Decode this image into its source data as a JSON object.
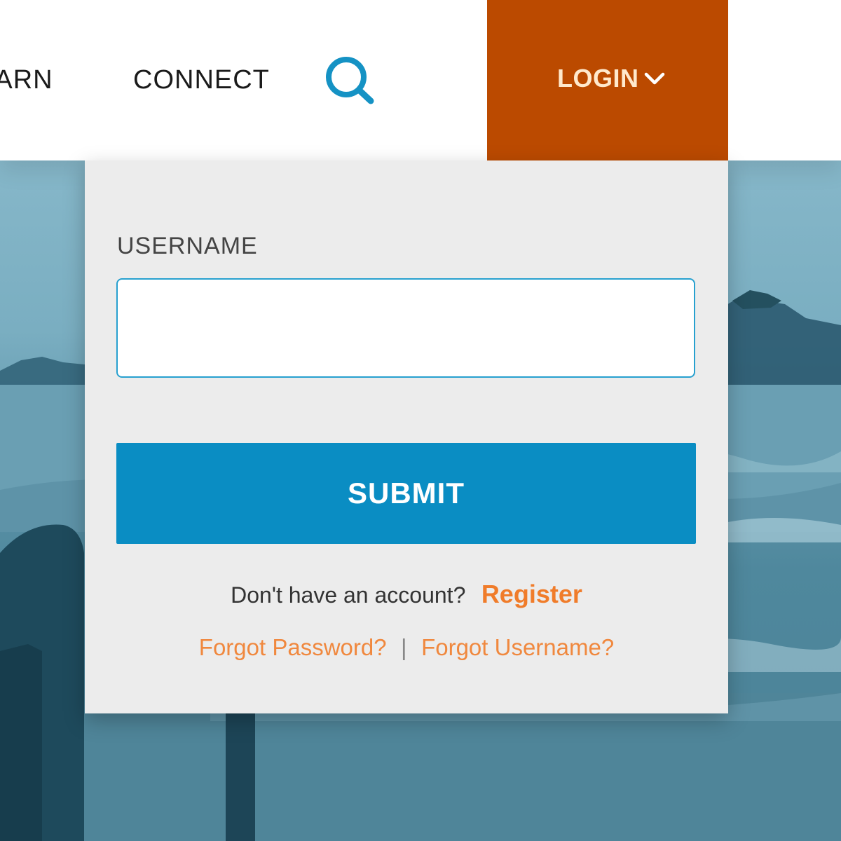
{
  "header": {
    "nav": {
      "learn_label": "EARN",
      "connect_label": "CONNECT"
    },
    "search_icon": "search-icon",
    "login": {
      "label": "LOGIN",
      "icon": "chevron-down-icon",
      "color": "#bb4a00"
    }
  },
  "login_panel": {
    "username_label": "USERNAME",
    "username_value": "",
    "submit_label": "SUBMIT",
    "no_account_text": "Don't have an account?",
    "register_label": "Register",
    "forgot_password_label": "Forgot Password?",
    "separator": "|",
    "forgot_username_label": "Forgot Username?"
  },
  "colors": {
    "accent_blue": "#0a8dc3",
    "link_orange": "#f07c2a",
    "panel_bg": "#ececec"
  }
}
